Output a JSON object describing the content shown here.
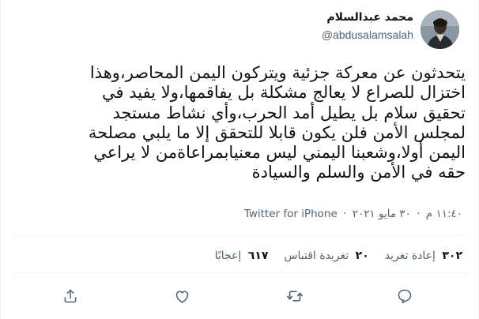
{
  "user": {
    "display_name": "محمد عبدالسلام",
    "handle": "@abdusalamsalah"
  },
  "tweet": {
    "lines": [
      "يتحدثون عن معركة جزئية ويتركون اليمن المحاصر،وهذا",
      "اختزال للصراع لا يعالج مشكلة بل يفاقمها،ولا يفيد في",
      "تحقيق سلام بل يطيل أمد الحرب،وأي نشاط مستجد",
      "لمجلس الأمن فلن يكون قابلا للتحقق إلا ما يلبي مصلحة",
      "اليمن أولا،وشعبنا اليمني ليس معنيابمراعاةمن لا يراعي",
      "حقه في الأمن والسلم والسيادة"
    ]
  },
  "meta": {
    "time": "١١:٤٠ م",
    "date": "٣٠ مايو ٢٠٢١",
    "source": "Twitter for iPhone"
  },
  "stats": {
    "retweets": {
      "count": "٣٠٢",
      "label": "إعادة تغريد"
    },
    "quotes": {
      "count": "٢٠",
      "label": "تغريدة اقتباس"
    },
    "likes": {
      "count": "٦١٧",
      "label": "إعجابًا"
    }
  },
  "icons": {
    "reply": "reply-icon",
    "retweet": "retweet-icon",
    "like": "heart-icon",
    "share": "share-icon"
  },
  "colors": {
    "text": "#0f1419",
    "secondary": "#536471",
    "divider": "#eff3f4"
  }
}
